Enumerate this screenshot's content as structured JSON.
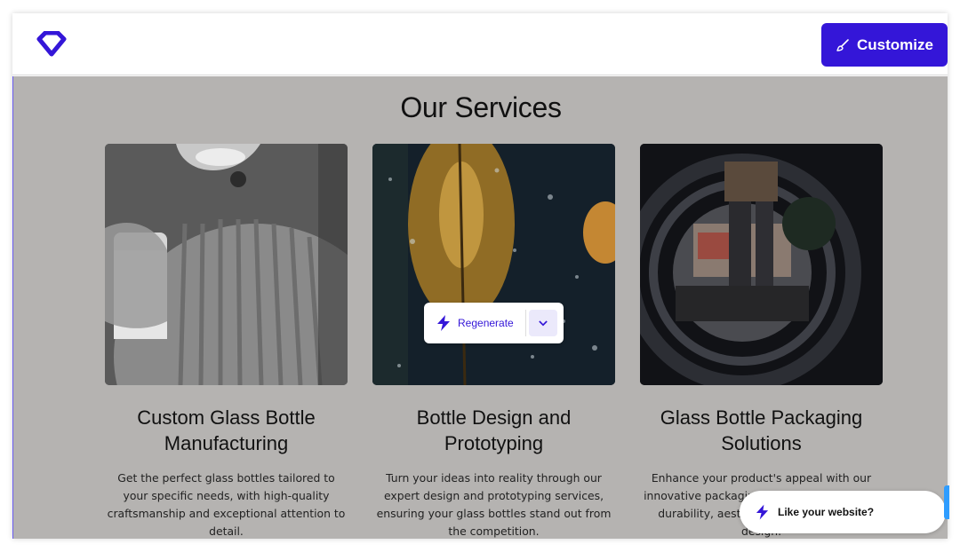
{
  "header": {
    "logo_icon": "diamond-logo-icon",
    "customize_label": "Customize",
    "customize_icon": "brush-icon",
    "accent_color": "#3416d8"
  },
  "main": {
    "title": "Our Services",
    "cards": [
      {
        "title": "Custom Glass Bottle Manufacturing",
        "description": "Get the perfect glass bottles tailored to your specific needs, with high-quality craftsmanship and exceptional attention to detail."
      },
      {
        "title": "Bottle Design and Prototyping",
        "description": "Turn your ideas into reality through our expert design and prototyping services, ensuring your glass bottles stand out from the competition."
      },
      {
        "title": "Glass Bottle Packaging Solutions",
        "description": "Enhance your product's appeal with our innovative packaging solutions, combining durability, aesthetics and sustainable design."
      }
    ]
  },
  "regenerate": {
    "label": "Regenerate",
    "icon": "lightning-icon",
    "dropdown_icon": "chevron-down-icon"
  },
  "feedback": {
    "label": "Like your website?",
    "icon": "lightning-icon"
  }
}
